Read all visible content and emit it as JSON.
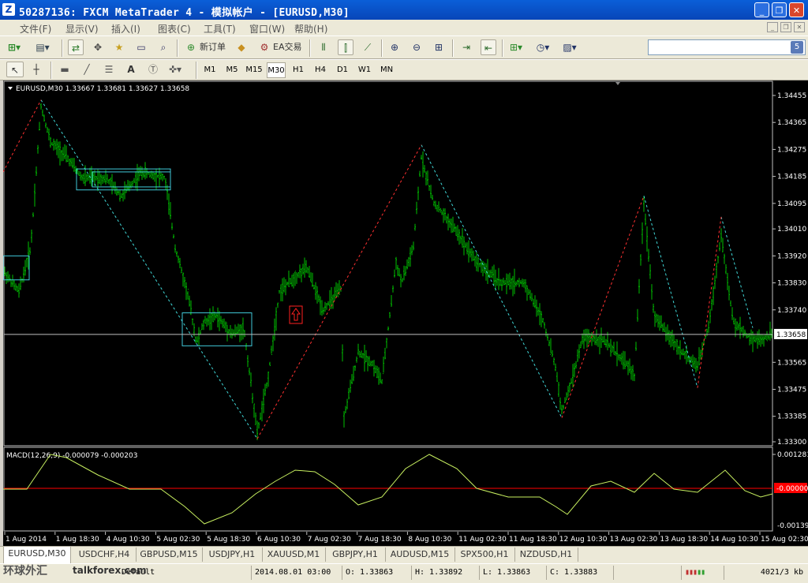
{
  "window": {
    "title": "50287136: FXCM MetaTrader 4 - 模拟帐户 - [EURUSD,M30]",
    "app_icon": "Z",
    "buttons": [
      "_",
      "❐",
      "✕"
    ]
  },
  "menu": {
    "items": [
      "文件(F)",
      "显示(V)",
      "插入(I)",
      "图表(C)",
      "工具(T)",
      "窗口(W)",
      "帮助(H)"
    ],
    "mdi_buttons": [
      "_",
      "❐",
      "✕"
    ]
  },
  "toolbar1": {
    "new_order_label": "新订单",
    "ea_label": "EA交易",
    "icons": [
      "new-chart-icon",
      "profiles-icon",
      "market-watch-icon",
      "navigator-icon",
      "data-window-icon",
      "terminal-icon",
      "strategy-tester-icon",
      "new-order-icon",
      "metaeditor-icon",
      "ea-trading-icon",
      "bar-chart-icon",
      "candlestick-icon",
      "line-chart-icon",
      "zoom-in-icon",
      "zoom-out-icon",
      "tile-windows-icon",
      "autoscroll-icon",
      "chart-shift-icon",
      "indicators-icon",
      "periods-icon",
      "templates-icon",
      "search-icon"
    ]
  },
  "search": {
    "placeholder": "",
    "button_icon": "search-icon",
    "badge": "5"
  },
  "toolbar2": {
    "timeframes": [
      "M1",
      "M5",
      "M15",
      "M30",
      "H1",
      "H4",
      "D1",
      "W1",
      "MN"
    ],
    "selected": "M30",
    "tool_icons": [
      "cursor-icon",
      "crosshair-icon",
      "rectangle-icon",
      "trendline-icon",
      "fibonacci-icon",
      "text-icon",
      "text-label-icon",
      "arrows-icon"
    ],
    "text_tool_label": "A"
  },
  "chart": {
    "symbol_info": "EURUSD,M30  1.33667 1.33681 1.33627 1.33658",
    "price_ticks": [
      "1.34455",
      "1.34365",
      "1.34275",
      "1.34185",
      "1.34095",
      "1.34010",
      "1.33920",
      "1.33830",
      "1.33740",
      "1.33658",
      "1.33565",
      "1.33475",
      "1.33385",
      "1.33300"
    ],
    "current_price": "1.33658",
    "macd_info": "MACD(12,26,9) -0.000079 -0.000203",
    "macd_ticks": [
      "0.001281",
      "-0.00000",
      "-0.001392"
    ],
    "time_ticks": [
      "1 Aug 2014",
      "1 Aug 18:30",
      "4 Aug 10:30",
      "5 Aug 02:30",
      "5 Aug 18:30",
      "6 Aug 10:30",
      "7 Aug 02:30",
      "7 Aug 18:30",
      "8 Aug 10:30",
      "11 Aug 02:30",
      "11 Aug 18:30",
      "12 Aug 10:30",
      "13 Aug 02:30",
      "13 Aug 18:30",
      "14 Aug 10:30",
      "15 Aug 02:30"
    ],
    "colors": {
      "bars": "#00c000",
      "macd": "#c8f060",
      "zero_line": "#ff0000",
      "zigzag_up": "#ff3030",
      "zigzag_down": "#40d8d8",
      "box": "#40c8d8"
    }
  },
  "tabs": {
    "items": [
      "EURUSD,M30",
      "USDCHF,H4",
      "GBPUSD,M15",
      "USDJPY,H1",
      "XAUUSD,M1",
      "GBPJPY,H1",
      "AUDUSD,M15",
      "SPX500,H1",
      "NZDUSD,H1"
    ],
    "active": "EURUSD,M30"
  },
  "status": {
    "watermark_cn": "环球外汇",
    "watermark_en": "talkforex.com",
    "help_hint": "Default",
    "datetime": "2014.08.01 03:00",
    "open": "O: 1.33863",
    "high": "H: 1.33892",
    "low": "L: 1.33863",
    "close": "C: 1.33883",
    "traffic": "4021/3 kb"
  }
}
